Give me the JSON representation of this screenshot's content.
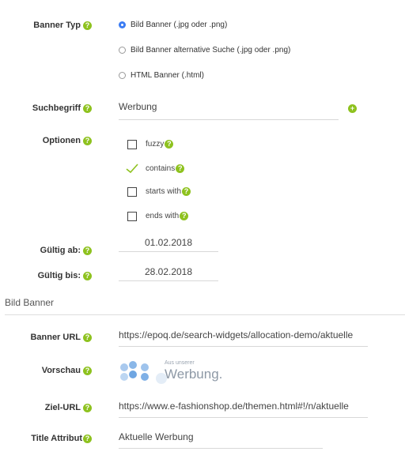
{
  "banner_type": {
    "label": "Banner Typ",
    "options": [
      "Bild Banner (.jpg oder .png)",
      "Bild Banner alternative Suche (.jpg oder .png)",
      "HTML Banner (.html)"
    ],
    "selected": "Bild Banner (.jpg oder .png)"
  },
  "search_term": {
    "label": "Suchbegriff",
    "value": "Werbung"
  },
  "options": {
    "label": "Optionen",
    "items": [
      {
        "label": "fuzzy",
        "checked": false
      },
      {
        "label": "contains",
        "checked": true
      },
      {
        "label": "starts with",
        "checked": false
      },
      {
        "label": "ends with",
        "checked": false
      }
    ]
  },
  "valid_from": {
    "label": "Gültig ab:",
    "value": "01.02.2018"
  },
  "valid_to": {
    "label": "Gültig bis:",
    "value": "28.02.2018"
  },
  "section_title": "Bild Banner",
  "banner_url": {
    "label": "Banner URL",
    "value": "https://epoq.de/search-widgets/allocation-demo/aktuelle"
  },
  "preview": {
    "label": "Vorschau",
    "line1": "Aus unserer",
    "line2": "Werbung."
  },
  "target_url": {
    "label": "Ziel-URL",
    "value": "https://www.e-fashionshop.de/themen.html#!/n/aktuelle"
  },
  "title_attr": {
    "label": "Title Attribut",
    "value": "Aktuelle Werbung"
  },
  "help_icon_glyph": "?",
  "colors": {
    "help": "#8ec21f",
    "radio_selected": "#3b7cf3",
    "check": "#8ec21f"
  }
}
